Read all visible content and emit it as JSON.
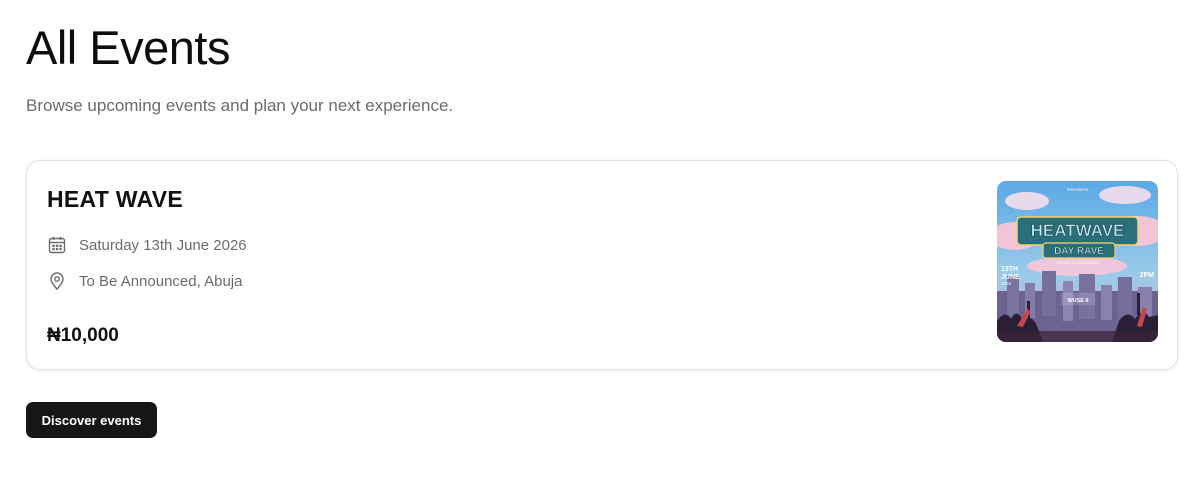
{
  "header": {
    "title": "All Events",
    "subtitle": "Browse upcoming events and plan your next experience."
  },
  "events": [
    {
      "title": "HEAT WAVE",
      "date_icon": "calendar-icon",
      "date": "Saturday 13th June 2026",
      "location_icon": "map-pin-icon",
      "location": "To Be Announced, Abuja",
      "price": "₦10,000",
      "poster": {
        "presents": "PRESENTS",
        "headline_1": "HEATWAVE",
        "headline_2": "DAY RAVE",
        "tagline": "THE SUN IN YOUR HANDS",
        "date_line_1": "13TH",
        "date_line_2": "JUNE",
        "date_line_3": "2026",
        "time": "2PM",
        "brand": "WUSE II"
      }
    }
  ],
  "actions": {
    "discover_label": "Discover events"
  },
  "colors": {
    "button_bg": "#161616",
    "card_border": "#e3e3e3",
    "muted_text": "#6b6b6b"
  }
}
